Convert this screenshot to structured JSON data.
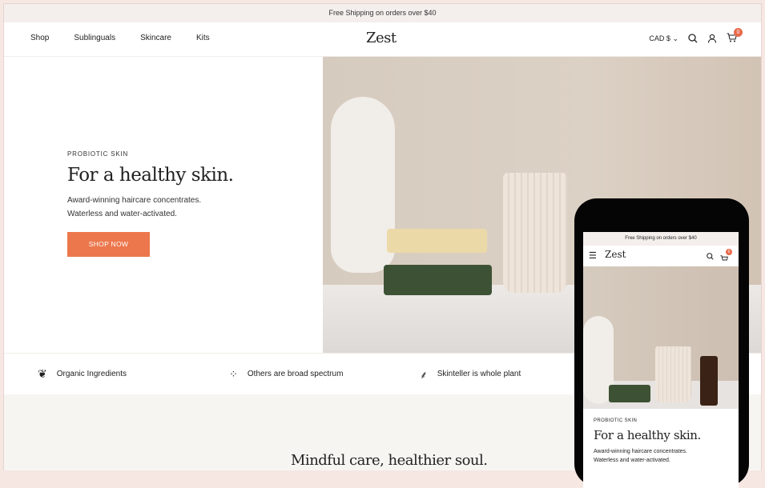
{
  "announcement": "Free Shipping on orders over $40",
  "nav": [
    "Shop",
    "Sublinguals",
    "Skincare",
    "Kits"
  ],
  "logo": "Zest",
  "currency": "CAD $",
  "cart_count": "0",
  "hero": {
    "eyebrow": "PROBIOTIC SKIN",
    "title": "For a healthy skin.",
    "sub1": "Award-winning haircare concentrates.",
    "sub2": "Waterless and water-activated.",
    "button": "SHOP NOW"
  },
  "features": [
    {
      "icon": "leaf-icon",
      "label": "Organic Ingredients"
    },
    {
      "icon": "sparkle-dots-icon",
      "label": "Others are broad spectrum"
    },
    {
      "icon": "plant-icon",
      "label": "Skinteller is whole plant"
    }
  ],
  "section_title": "Mindful care, healthier soul.",
  "accent": "#ec774c"
}
